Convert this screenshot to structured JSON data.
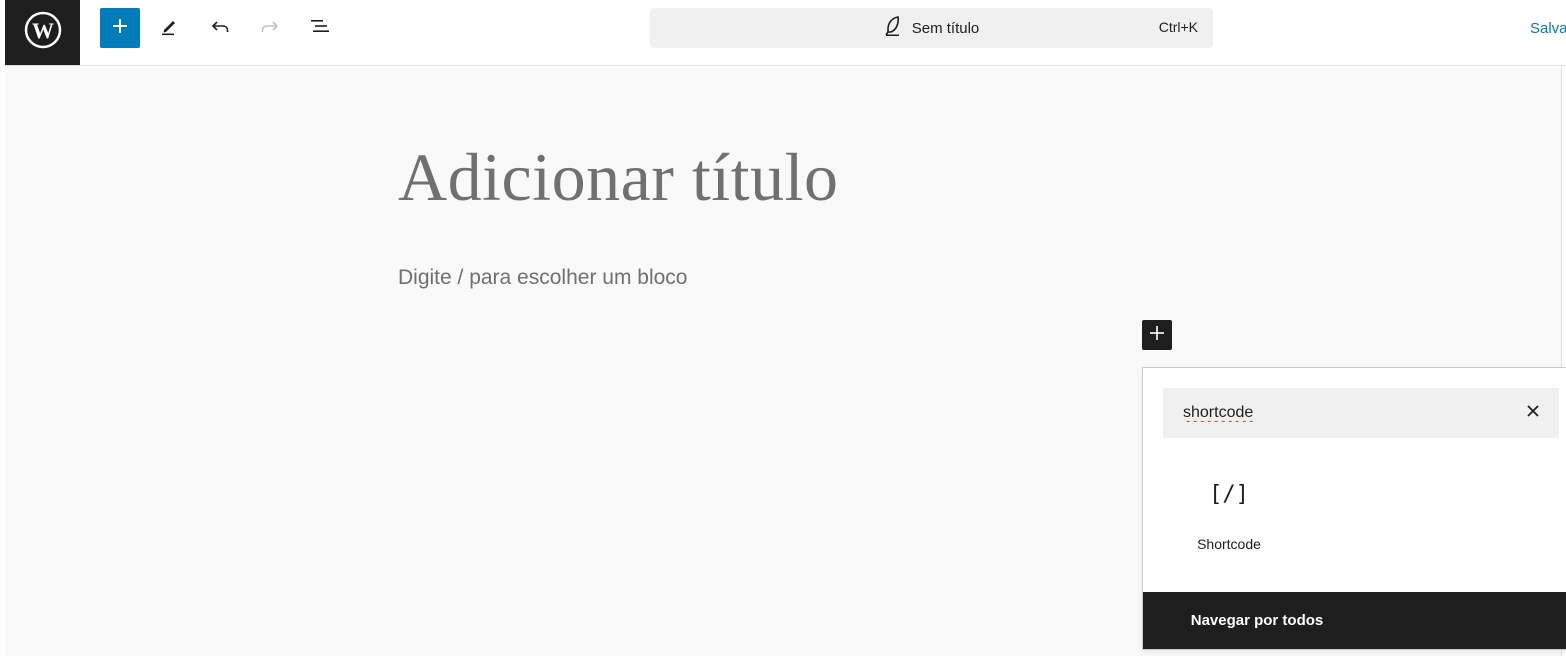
{
  "toolbar": {
    "logo_icon": "wordpress-logo-icon",
    "inserter_icon": "plus-icon",
    "tools_icon": "pencil-icon",
    "undo_icon": "undo-icon",
    "redo_icon": "redo-icon",
    "outline_icon": "document-overview-icon",
    "inserter_color": "#007cba"
  },
  "command_bar": {
    "icon": "feather-icon",
    "title": "Sem título",
    "shortcut": "Ctrl+K"
  },
  "save_label": "Salva",
  "editor": {
    "title_placeholder": "Adicionar título",
    "block_placeholder": "Digite / para escolher um bloco",
    "add_block_icon": "plus-icon"
  },
  "quick_inserter": {
    "search_value": "shortcode",
    "clear_icon": "close-icon",
    "results": [
      {
        "icon": "shortcode-icon",
        "icon_text": "[/]",
        "label": "Shortcode"
      }
    ],
    "browse_all_label": "Navegar por todos"
  },
  "colors": {
    "accent": "#007cba",
    "dark": "#1e1e1e",
    "canvas_bg": "#f9f9f9"
  }
}
